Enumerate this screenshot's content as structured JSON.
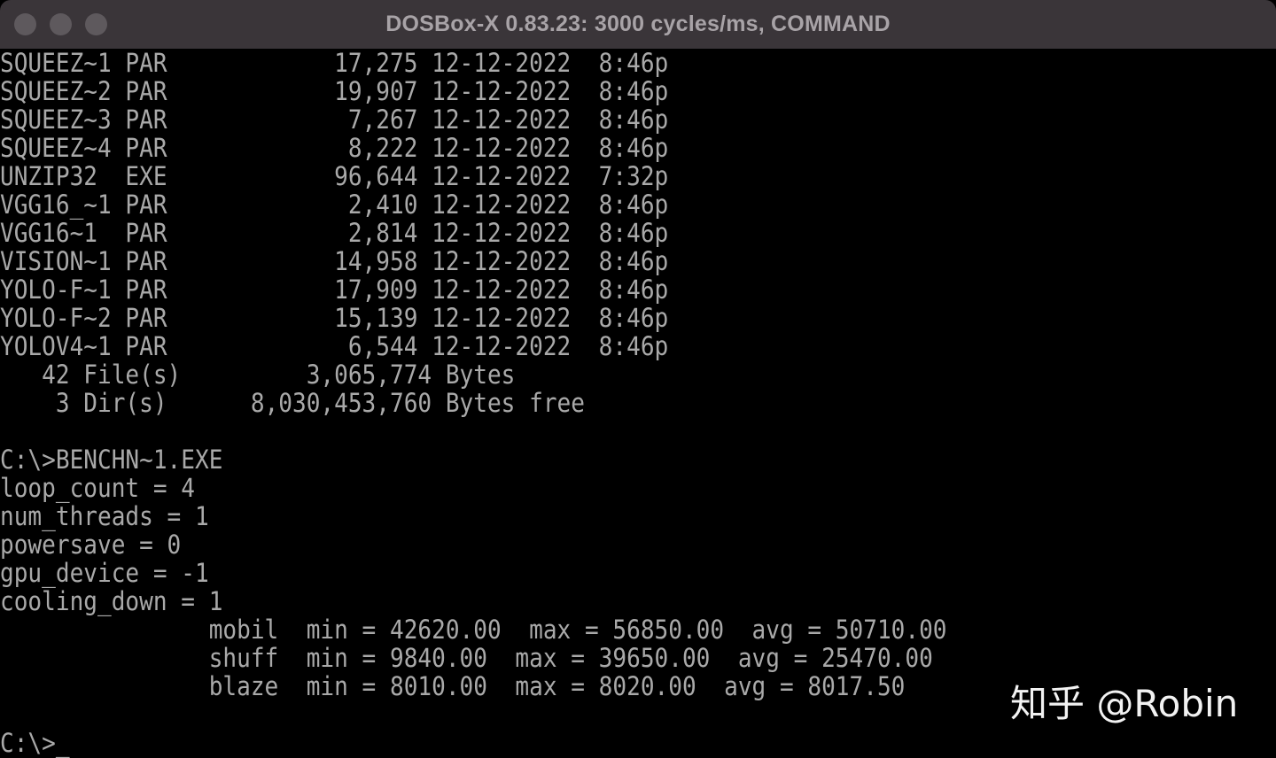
{
  "window": {
    "title": "DOSBox-X 0.83.23: 3000 cycles/ms, COMMAND"
  },
  "terminal": {
    "lines": [
      "SQUEEZ~1 PAR            17,275 12-12-2022  8:46p",
      "SQUEEZ~2 PAR            19,907 12-12-2022  8:46p",
      "SQUEEZ~3 PAR             7,267 12-12-2022  8:46p",
      "SQUEEZ~4 PAR             8,222 12-12-2022  8:46p",
      "UNZIP32  EXE            96,644 12-12-2022  7:32p",
      "VGG16_~1 PAR             2,410 12-12-2022  8:46p",
      "VGG16~1  PAR             2,814 12-12-2022  8:46p",
      "VISION~1 PAR            14,958 12-12-2022  8:46p",
      "YOLO-F~1 PAR            17,909 12-12-2022  8:46p",
      "YOLO-F~2 PAR            15,139 12-12-2022  8:46p",
      "YOLOV4~1 PAR             6,544 12-12-2022  8:46p",
      "   42 File(s)         3,065,774 Bytes",
      "    3 Dir(s)      8,030,453,760 Bytes free",
      "",
      "C:\\>BENCHN~1.EXE",
      "loop_count = 4",
      "num_threads = 1",
      "powersave = 0",
      "gpu_device = -1",
      "cooling_down = 1",
      "               mobil  min = 42620.00  max = 56850.00  avg = 50710.00",
      "               shuff  min = 9840.00  max = 39650.00  avg = 25470.00",
      "               blaze  min = 8010.00  max = 8020.00  avg = 8017.50",
      ""
    ],
    "prompt": "C:\\>",
    "cursor": "_"
  },
  "watermark": {
    "text": "知乎 @Robin"
  },
  "colors": {
    "titlebar": "#3a3539",
    "title_text": "#a8a3a7",
    "terminal_bg": "#000000",
    "terminal_text": "#a9a9a9",
    "watermark": "#f2f2f2"
  }
}
